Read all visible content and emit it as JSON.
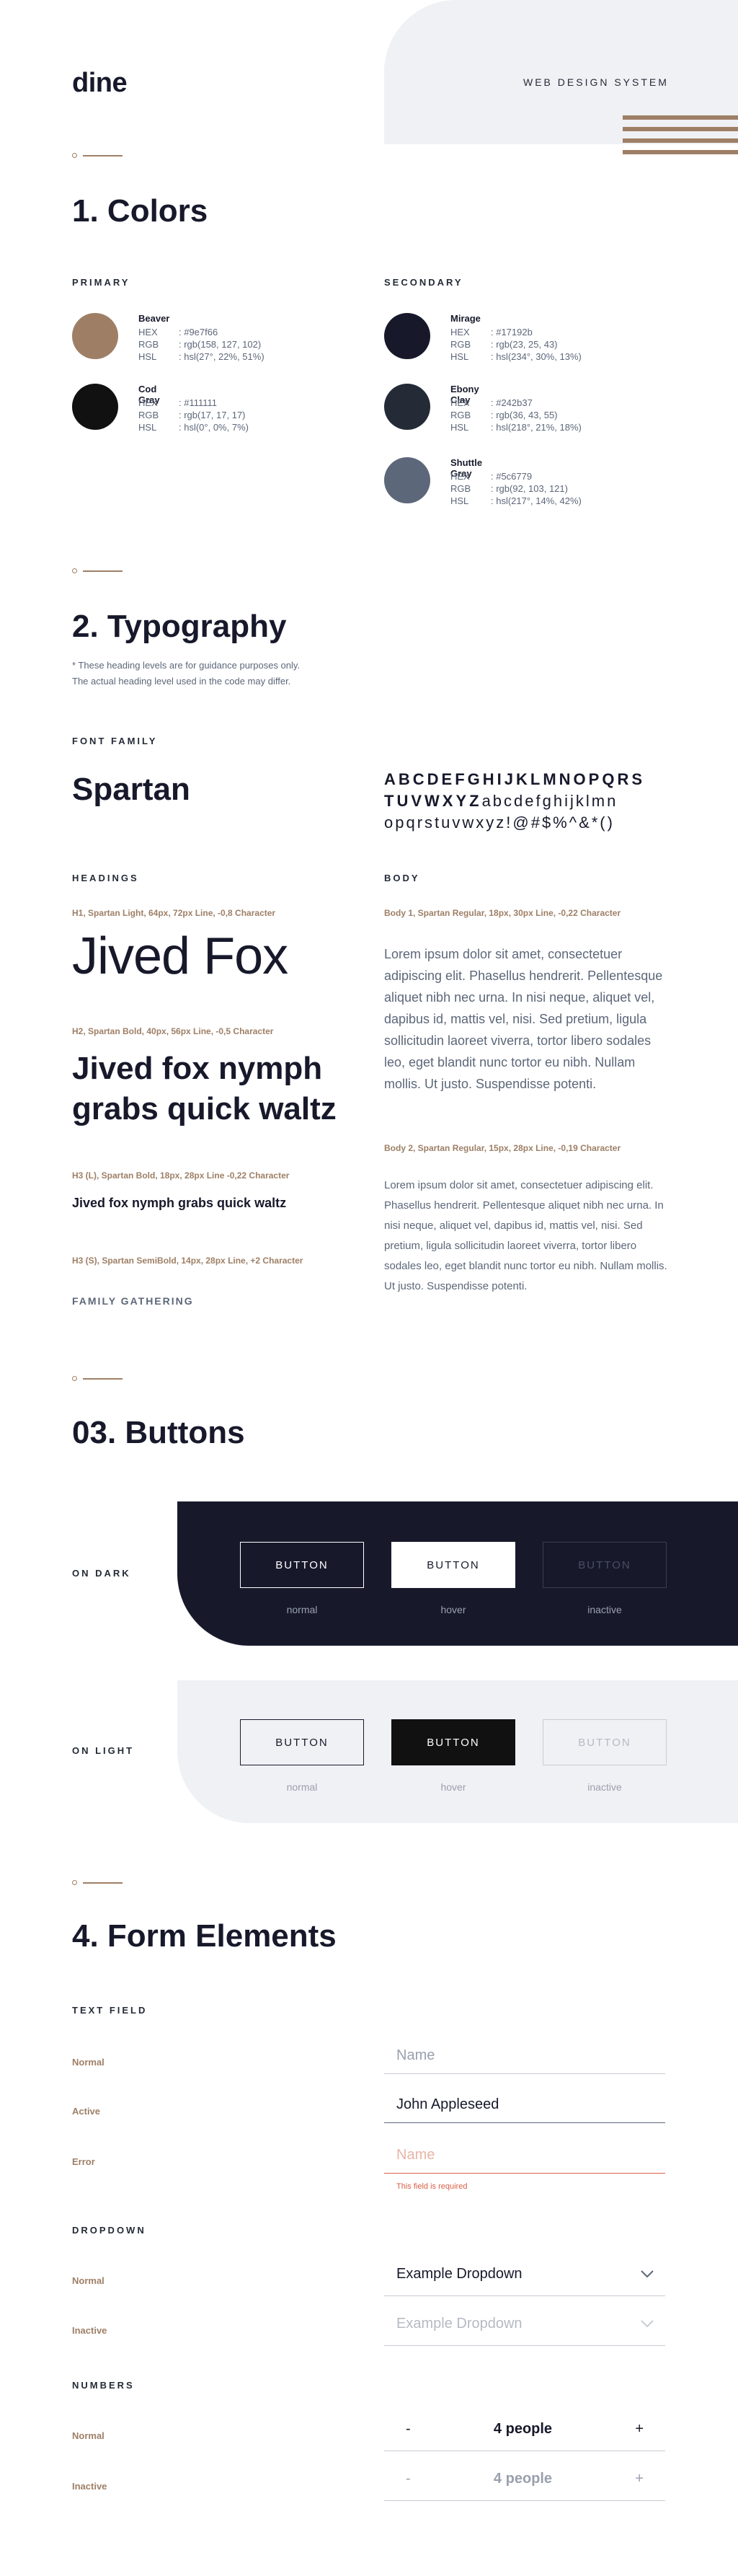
{
  "header": {
    "logo": "dine",
    "subtitle": "WEB DESIGN SYSTEM"
  },
  "colors": {
    "title": "1. Colors",
    "primary_label": "PRIMARY",
    "secondary_label": "SECONDARY",
    "primary": [
      {
        "name": "Beaver",
        "hex": ": #9e7f66",
        "rgb": ": rgb(158, 127, 102)",
        "hsl": ": hsl(27°, 22%, 51%)",
        "color": "#9e7f66"
      },
      {
        "name": "Cod Gray",
        "hex": ": #111111",
        "rgb": ": rgb(17, 17, 17)",
        "hsl": ": hsl(0°, 0%, 7%)",
        "color": "#111111"
      }
    ],
    "secondary": [
      {
        "name": "Mirage",
        "hex": ": #17192b",
        "rgb": ": rgb(23, 25, 43)",
        "hsl": ": hsl(234°, 30%, 13%)",
        "color": "#17192b"
      },
      {
        "name": "Ebony Clay",
        "hex": ": #242b37",
        "rgb": ": rgb(36, 43, 55)",
        "hsl": ": hsl(218°, 21%, 18%)",
        "color": "#242b37"
      },
      {
        "name": "Shuttle Gray",
        "hex": ": #5c6779",
        "rgb": ": rgb(92, 103, 121)",
        "hsl": ": hsl(217°, 14%, 42%)",
        "color": "#5c6779"
      }
    ],
    "keys": {
      "hex": "HEX",
      "rgb": "RGB",
      "hsl": "HSL"
    }
  },
  "typography": {
    "title": "2. Typography",
    "note_1": "* These heading levels are for guidance purposes only.",
    "note_2": "The actual heading level used in the code may differ.",
    "font_family_label": "FONT FAMILY",
    "font_name": "Spartan",
    "alphabet_upper_1": "ABCDEFGHIJKLMNOPQRS",
    "alphabet_upper_2": "TUVWXYZ",
    "alphabet_lower_1": "abcdefghijklmn",
    "alphabet_lower_2": "opqrstuvwxyz!@#$%^&*()",
    "headings_label": "HEADINGS",
    "body_label": "BODY",
    "h1_spec": "H1, Spartan Light, 64px, 72px Line, -0,8 Character",
    "h1_demo": "Jived Fox",
    "h2_spec": "H2, Spartan Bold, 40px, 56px Line, -0,5 Character",
    "h2_demo": "Jived fox nymph grabs quick waltz",
    "h3_spec": "H3 (L), Spartan Bold, 18px, 28px Line -0,22 Character",
    "h3_demo": "Jived fox nymph grabs quick waltz",
    "h5_spec": "H3 (S), Spartan SemiBold, 14px, 28px Line, +2 Character",
    "h5_demo": "FAMILY GATHERING",
    "body1_spec": "Body 1, Spartan Regular, 18px, 30px Line, -0,22 Character",
    "body1_text": "Lorem ipsum dolor sit amet, consectetuer adipiscing elit. Phasellus hendrerit. Pellentesque aliquet nibh nec urna. In nisi neque, aliquet vel, dapibus id, mattis vel, nisi. Sed pretium, ligula sollicitudin laoreet viverra, tortor libero sodales leo, eget blandit nunc tortor eu nibh. Nullam mollis. Ut justo. Suspendisse potenti.",
    "body2_spec": "Body 2, Spartan Regular, 15px, 28px Line, -0,19 Character",
    "body2_text": "Lorem ipsum dolor sit amet, consectetuer adipiscing elit. Phasellus hendrerit. Pellentesque aliquet nibh nec urna. In nisi neque, aliquet vel, dapibus id, mattis vel, nisi. Sed pretium, ligula sollicitudin laoreet viverra, tortor libero sodales leo, eget blandit nunc tortor eu nibh. Nullam mollis. Ut justo. Suspendisse potenti."
  },
  "buttons": {
    "title": "03. Buttons",
    "on_dark": "ON DARK",
    "on_light": "ON LIGHT",
    "button_label": "BUTTON",
    "states": [
      "normal",
      "hover",
      "inactive"
    ]
  },
  "forms": {
    "title": "4. Form Elements",
    "text_field_label": "TEXT FIELD",
    "normal": "Normal",
    "active": "Active",
    "error": "Error",
    "inactive": "Inactive",
    "placeholder": "Name",
    "active_value": "John Appleseed",
    "error_message": "This field is required",
    "dropdown_label": "DROPDOWN",
    "dropdown_value": "Example Dropdown",
    "numbers_label": "NUMBERS",
    "minus": "-",
    "plus": "+",
    "number_value": "4 people"
  }
}
